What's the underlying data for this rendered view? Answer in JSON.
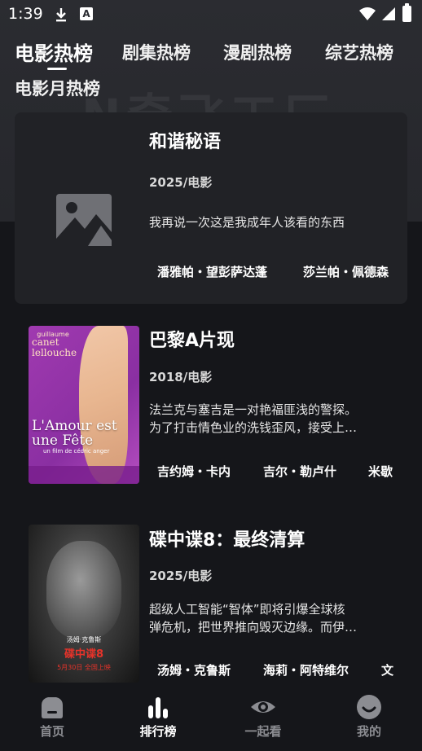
{
  "status_bar": {
    "time": "1:39"
  },
  "banner_text": "N奇飞工厂",
  "tabs": [
    {
      "label": "电影热榜",
      "active": true
    },
    {
      "label": "剧集热榜"
    },
    {
      "label": "漫剧热榜"
    },
    {
      "label": "综艺热榜"
    },
    {
      "label": "电影月热榜"
    }
  ],
  "items": [
    {
      "title": "和谐秘语",
      "meta": "2025/电影",
      "desc": "我再说一次这是我成年人该看的东西",
      "cast": [
        "潘雅帕・望彭萨达蓬",
        "莎兰帕・佩德森"
      ],
      "poster": "image-placeholder-icon"
    },
    {
      "title": "巴黎A片现",
      "meta": "2018/电影",
      "desc": "法兰克与塞吉是一对艳福匪浅的警探。\n为了打击情色业的洗钱歪风，接受上…",
      "cast": [
        "吉约姆・卡内",
        "吉尔・勒卢什",
        "米歇"
      ],
      "poster_text": {
        "top": "guillaume",
        "name1": "canet",
        "name2": "lellouche",
        "title": "L'Amour est une Fête",
        "sub": "un film de cédric anger"
      }
    },
    {
      "title": "碟中谍8：最终清算",
      "meta": "2025/电影",
      "desc": "超级人工智能“智体”即将引爆全球核\n弹危机，把世界推向毁灭边缘。而伊…",
      "cast": [
        "汤姆・克鲁斯",
        "海莉・阿特维尔",
        "文"
      ],
      "poster_text": {
        "name": "汤姆·克鲁斯",
        "title": "碟中谍8",
        "date": "5月30日 全国上映"
      }
    }
  ],
  "nav": [
    {
      "label": "首页",
      "icon": "home-icon"
    },
    {
      "label": "排行榜",
      "icon": "chart-icon",
      "active": true
    },
    {
      "label": "一起看",
      "icon": "eye-icon"
    },
    {
      "label": "我的",
      "icon": "smile-icon"
    }
  ],
  "colors": {
    "background": "#15161a",
    "card": "#212226",
    "banner": "#2b2c31",
    "inactive": "#8c8d92"
  }
}
